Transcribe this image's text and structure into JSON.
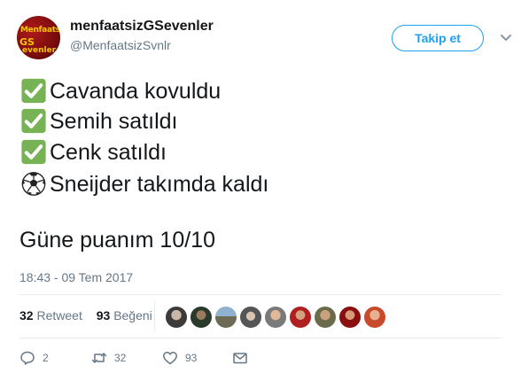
{
  "user": {
    "display_name": "menfaatsizGSevenler",
    "handle": "@MenfaatsizSvnlr",
    "avatar_text": [
      "Menfaatsiz",
      "GS",
      "evenler"
    ],
    "avatar_icon": "team-logo-avatar"
  },
  "follow_button": {
    "label": "Takip et"
  },
  "tweet": {
    "lines": [
      {
        "emoji": "check-mark-icon",
        "text": "Cavanda kovuldu"
      },
      {
        "emoji": "check-mark-icon",
        "text": "Semih satıldı"
      },
      {
        "emoji": "check-mark-icon",
        "text": "Cenk satıldı"
      },
      {
        "emoji": "soccer-ball-icon",
        "text": "Sneijder takımda kaldı"
      }
    ],
    "closing": "Güne puanım 10/10",
    "timestamp": "18:43 - 09 Tem 2017"
  },
  "stats": {
    "retweet_count": "32",
    "retweet_label": "Retweet",
    "like_count": "93",
    "like_label": "Beğeni"
  },
  "actions": {
    "reply_count": "2",
    "retweet_count": "32",
    "like_count": "93"
  },
  "colors": {
    "accent": "#1da1f2",
    "check_green": "#77b255",
    "muted": "#657786"
  }
}
